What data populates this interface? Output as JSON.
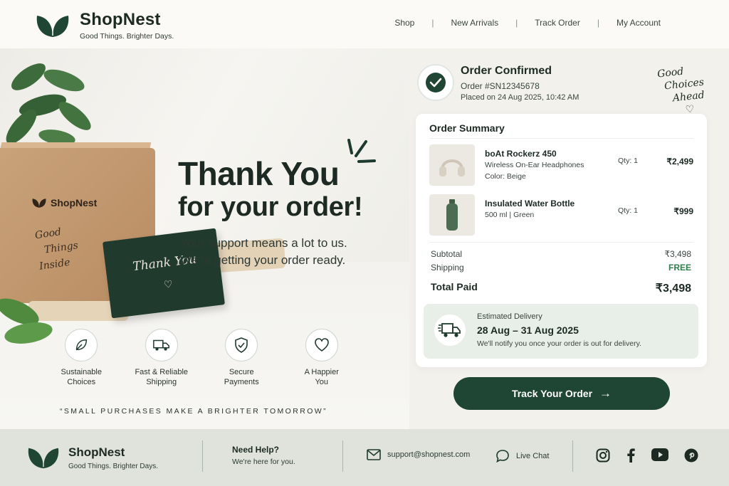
{
  "header": {
    "brand_name": "ShopNest",
    "brand_tagline": "Good Things. Brighter Days.",
    "nav": [
      "Shop",
      "New Arrivals",
      "Track Order",
      "My Account"
    ]
  },
  "hero": {
    "title_line1": "Thank You",
    "title_line2": "for your order!",
    "subtitle_line1": "Your support means a lot to us.",
    "subtitle_line2": "We're getting your order ready.",
    "box_brand": "ShopNest",
    "box_script": [
      "Good",
      "Things",
      "Inside"
    ],
    "card_script": "Thank You",
    "features": [
      {
        "icon": "leaf-icon",
        "line1": "Sustainable",
        "line2": "Choices"
      },
      {
        "icon": "truck-icon",
        "line1": "Fast & Reliable",
        "line2": "Shipping"
      },
      {
        "icon": "shield-check-icon",
        "line1": "Secure",
        "line2": "Payments"
      },
      {
        "icon": "heart-icon",
        "line1": "A Happier",
        "line2": "You"
      }
    ],
    "tagline": "“SMALL PURCHASES MAKE A BRIGHTER TOMORROW”"
  },
  "order": {
    "status": "Order Confirmed",
    "order_number": "Order #SN12345678",
    "placed_on": "Placed on 24 Aug 2025, 10:42 AM",
    "script_note": [
      "Good",
      "Choices",
      "Ahead"
    ]
  },
  "summary": {
    "title": "Order Summary",
    "items": [
      {
        "name": "boAt Rockerz 450",
        "desc": "Wireless On-Ear Headphones",
        "color": "Color: Beige",
        "qty": "Qty: 1",
        "price": "₹2,499",
        "icon": "headphones-icon"
      },
      {
        "name": "Insulated Water Bottle",
        "desc": "500 ml | Green",
        "color": "",
        "qty": "Qty: 1",
        "price": "₹999",
        "icon": "bottle-icon"
      }
    ],
    "subtotal_label": "Subtotal",
    "subtotal_value": "₹3,498",
    "shipping_label": "Shipping",
    "shipping_value": "FREE",
    "total_label": "Total Paid",
    "total_value": "₹3,498"
  },
  "delivery": {
    "label": "Estimated Delivery",
    "dates": "28 Aug – 31 Aug 2025",
    "note": "We'll notify you once your order is out for delivery."
  },
  "track_button": "Track Your Order",
  "footer": {
    "brand_name": "ShopNest",
    "brand_tagline": "Good Things. Brighter Days.",
    "help_title": "Need Help?",
    "help_sub": "We're here for you.",
    "email": "support@shopnest.com",
    "chat": "Live Chat",
    "socials": [
      "instagram-icon",
      "facebook-icon",
      "youtube-icon",
      "pinterest-icon"
    ]
  },
  "colors": {
    "brand_green": "#1f4535",
    "free_green": "#2e7d4c",
    "delivery_bg": "#e8efe9",
    "footer_bg": "#dfe3dc"
  }
}
